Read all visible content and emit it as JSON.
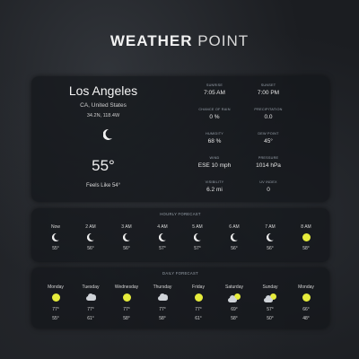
{
  "app": {
    "title_bold": "WEATHER",
    "title_light": " POINT"
  },
  "current": {
    "city": "Los Angeles",
    "region": "CA, United States",
    "coords": "34.2N, 118.4W",
    "icon": "moon-icon",
    "temp": "55°",
    "feels": "Feels Like 54°"
  },
  "stats": [
    {
      "label": "SUNRISE",
      "value": "7:05 AM"
    },
    {
      "label": "SUNSET",
      "value": "7:00 PM"
    },
    {
      "label": "CHANCE OF RAIN",
      "value": "0 %"
    },
    {
      "label": "PRECIPITATION",
      "value": "0.0"
    },
    {
      "label": "HUMIDITY",
      "value": "68 %"
    },
    {
      "label": "DEW POINT",
      "value": "45°"
    },
    {
      "label": "WIND",
      "value": "ESE 10 mph"
    },
    {
      "label": "PRESSURE",
      "value": "1014 hPa"
    },
    {
      "label": "VISIBILITY",
      "value": "6.2 mi"
    },
    {
      "label": "UV INDEX",
      "value": "0"
    }
  ],
  "hourly": {
    "label": "HOURLY FORECAST",
    "items": [
      {
        "time": "Now",
        "icon": "moon-icon",
        "temp": "55°"
      },
      {
        "time": "2 AM",
        "icon": "moon-icon",
        "temp": "56°"
      },
      {
        "time": "3 AM",
        "icon": "moon-icon",
        "temp": "56°"
      },
      {
        "time": "4 AM",
        "icon": "moon-icon",
        "temp": "57°"
      },
      {
        "time": "5 AM",
        "icon": "moon-icon",
        "temp": "57°"
      },
      {
        "time": "6 AM",
        "icon": "moon-icon",
        "temp": "56°"
      },
      {
        "time": "7 AM",
        "icon": "moon-icon",
        "temp": "56°"
      },
      {
        "time": "8 AM",
        "icon": "sun-icon",
        "temp": "58°"
      }
    ]
  },
  "daily": {
    "label": "DAILY FORECAST",
    "items": [
      {
        "day": "Monday",
        "icon": "sun-icon",
        "high": "77°",
        "low": "55°"
      },
      {
        "day": "Tuesday",
        "icon": "cloud-icon",
        "high": "77°",
        "low": "61°"
      },
      {
        "day": "Wednesday",
        "icon": "sun-icon",
        "high": "77°",
        "low": "58°"
      },
      {
        "day": "Thursday",
        "icon": "cloud-icon",
        "high": "77°",
        "low": "58°"
      },
      {
        "day": "Friday",
        "icon": "sun-icon",
        "high": "77°",
        "low": "61°"
      },
      {
        "day": "Saturday",
        "icon": "partly-cloudy-icon",
        "high": "69°",
        "low": "58°"
      },
      {
        "day": "Sunday",
        "icon": "partly-cloudy-icon",
        "high": "57°",
        "low": "50°"
      },
      {
        "day": "Monday",
        "icon": "sun-icon",
        "high": "66°",
        "low": "48°"
      }
    ]
  },
  "colors": {
    "sun": "#e6ec3c",
    "panel": "#14161a",
    "label": "#9aa3ad"
  }
}
